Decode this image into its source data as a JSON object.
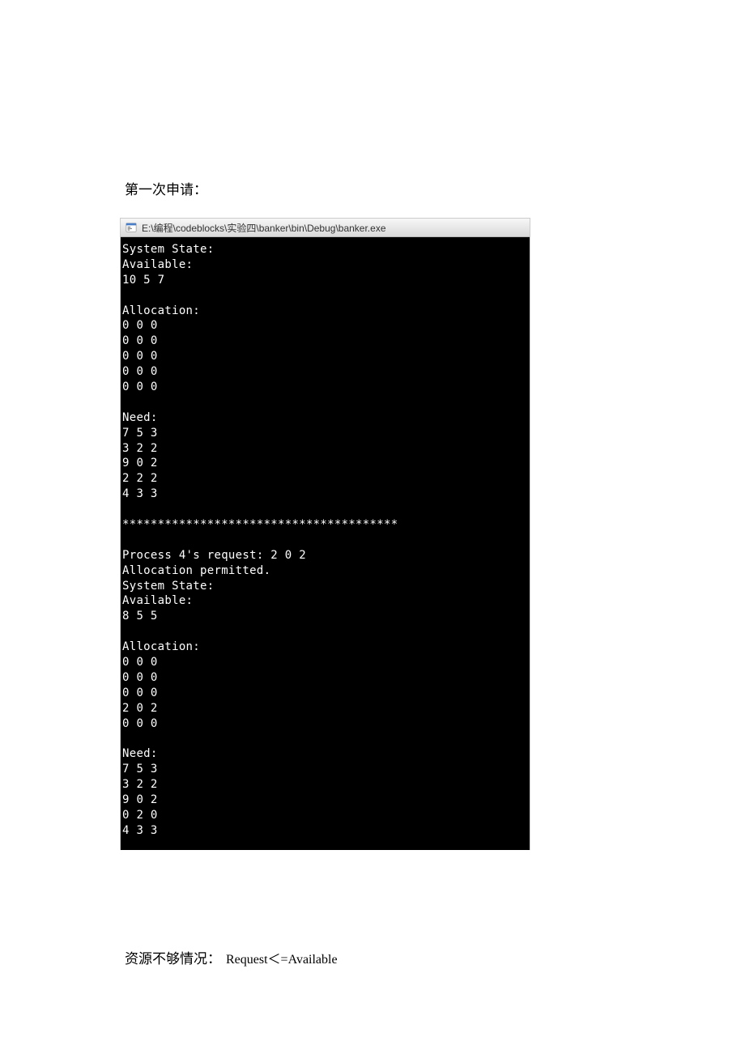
{
  "heading": "第一次申请：",
  "window": {
    "title": "E:\\编程\\codeblocks\\实验四\\banker\\bin\\Debug\\banker.exe"
  },
  "console": {
    "lines": [
      "System State:",
      "Available:",
      "10 5 7",
      "",
      "Allocation:",
      "0 0 0",
      "0 0 0",
      "0 0 0",
      "0 0 0",
      "0 0 0",
      "",
      "Need:",
      "7 5 3",
      "3 2 2",
      "9 0 2",
      "2 2 2",
      "4 3 3",
      "",
      "***************************************",
      "",
      "Process 4's request: 2 0 2",
      "Allocation permitted.",
      "System State:",
      "Available:",
      "8 5 5",
      "",
      "Allocation:",
      "0 0 0",
      "0 0 0",
      "0 0 0",
      "2 0 2",
      "0 0 0",
      "",
      "Need:",
      "7 5 3",
      "3 2 2",
      "9 0 2",
      "0 2 0",
      "4 3 3"
    ]
  },
  "footnote": {
    "cjk": "资源不够情况：",
    "latin": "Request＜=Available"
  },
  "chart_data": {
    "type": "table",
    "bankers_algorithm": {
      "initial": {
        "available": [
          10,
          5,
          7
        ],
        "allocation": [
          [
            0,
            0,
            0
          ],
          [
            0,
            0,
            0
          ],
          [
            0,
            0,
            0
          ],
          [
            0,
            0,
            0
          ],
          [
            0,
            0,
            0
          ]
        ],
        "need": [
          [
            7,
            5,
            3
          ],
          [
            3,
            2,
            2
          ],
          [
            9,
            0,
            2
          ],
          [
            2,
            2,
            2
          ],
          [
            4,
            3,
            3
          ]
        ]
      },
      "request": {
        "process": 4,
        "vector": [
          2,
          0,
          2
        ],
        "result": "Allocation permitted."
      },
      "after": {
        "available": [
          8,
          5,
          5
        ],
        "allocation": [
          [
            0,
            0,
            0
          ],
          [
            0,
            0,
            0
          ],
          [
            0,
            0,
            0
          ],
          [
            2,
            0,
            2
          ],
          [
            0,
            0,
            0
          ]
        ],
        "need": [
          [
            7,
            5,
            3
          ],
          [
            3,
            2,
            2
          ],
          [
            9,
            0,
            2
          ],
          [
            0,
            2,
            0
          ],
          [
            4,
            3,
            3
          ]
        ]
      }
    }
  }
}
